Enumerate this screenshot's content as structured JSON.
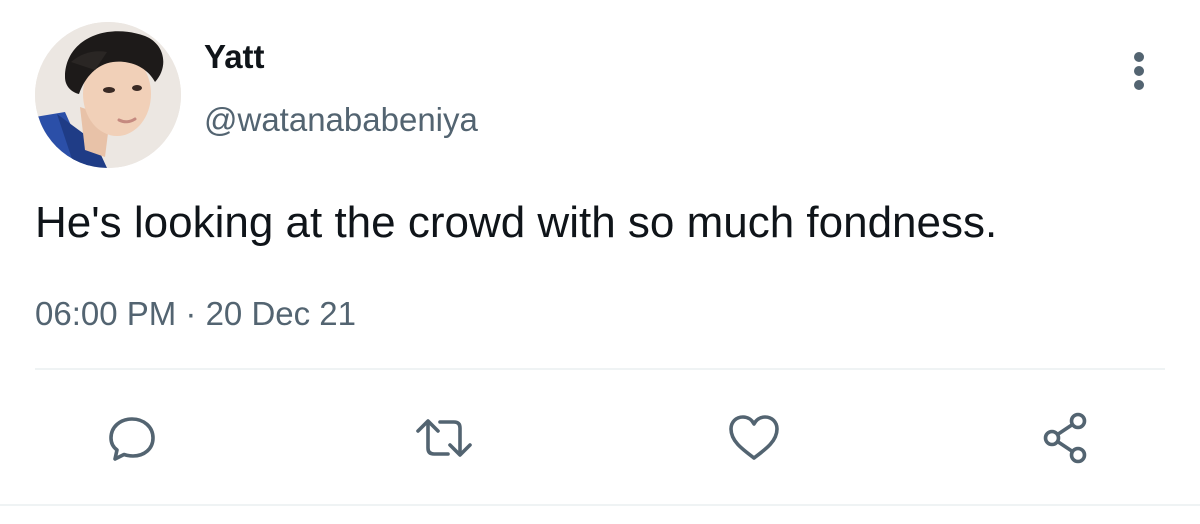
{
  "author": {
    "name": "Yatt",
    "handle": "@watanababeniya"
  },
  "tweet": {
    "text": "He's looking at the crowd with so much fondness.",
    "time": "06:00 PM",
    "separator": " · ",
    "date": "20 Dec 21"
  },
  "actions": {
    "reply_icon": "speech-bubble-icon",
    "retweet_icon": "retweet-arrows-icon",
    "like_icon": "heart-icon",
    "share_icon": "share-nodes-icon"
  },
  "colors": {
    "text_primary": "#0f1419",
    "text_secondary": "#536471",
    "divider": "#eff3f4",
    "background": "#ffffff"
  }
}
